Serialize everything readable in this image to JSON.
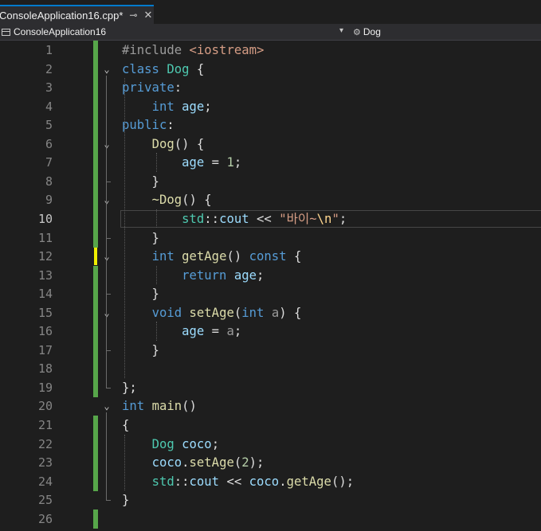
{
  "tab": {
    "title": "ConsoleApplication16.cpp*",
    "pin_icon": "pin-icon",
    "close_icon": "close-icon",
    "pin": "⊸",
    "close": "✕"
  },
  "navbar": {
    "project": "ConsoleApplication16",
    "scope": "Dog",
    "dropdown": "▾",
    "class_icon": "⚙"
  },
  "editor": {
    "active_line": 10,
    "lines": [
      {
        "n": "1"
      },
      {
        "n": "2"
      },
      {
        "n": "3"
      },
      {
        "n": "4"
      },
      {
        "n": "5"
      },
      {
        "n": "6"
      },
      {
        "n": "7"
      },
      {
        "n": "8"
      },
      {
        "n": "9"
      },
      {
        "n": "10"
      },
      {
        "n": "11"
      },
      {
        "n": "12"
      },
      {
        "n": "13"
      },
      {
        "n": "14"
      },
      {
        "n": "15"
      },
      {
        "n": "16"
      },
      {
        "n": "17"
      },
      {
        "n": "18"
      },
      {
        "n": "19"
      },
      {
        "n": "20"
      },
      {
        "n": "21"
      },
      {
        "n": "22"
      },
      {
        "n": "23"
      },
      {
        "n": "24"
      },
      {
        "n": "25"
      },
      {
        "n": "26"
      }
    ],
    "code": [
      [
        {
          "c": "p",
          "x": "#include "
        },
        {
          "c": "i",
          "x": "<iostream>"
        }
      ],
      [
        {
          "c": "k",
          "x": "class "
        },
        {
          "c": "t",
          "x": "Dog"
        },
        {
          "c": "",
          "x": " {"
        }
      ],
      [
        {
          "c": "k",
          "x": "private"
        },
        {
          "c": "",
          "x": ":"
        }
      ],
      [
        {
          "c": "",
          "x": "    "
        },
        {
          "c": "k",
          "x": "int"
        },
        {
          "c": "",
          "x": " "
        },
        {
          "c": "v",
          "x": "age"
        },
        {
          "c": "",
          "x": ";"
        }
      ],
      [
        {
          "c": "k",
          "x": "public"
        },
        {
          "c": "",
          "x": ":"
        }
      ],
      [
        {
          "c": "",
          "x": "    "
        },
        {
          "c": "f",
          "x": "Dog"
        },
        {
          "c": "",
          "x": "() {"
        }
      ],
      [
        {
          "c": "",
          "x": "        "
        },
        {
          "c": "v",
          "x": "age"
        },
        {
          "c": "",
          "x": " = "
        },
        {
          "c": "n",
          "x": "1"
        },
        {
          "c": "",
          "x": ";"
        }
      ],
      [
        {
          "c": "",
          "x": "    }"
        }
      ],
      [
        {
          "c": "",
          "x": "    "
        },
        {
          "c": "f",
          "x": "~Dog"
        },
        {
          "c": "",
          "x": "() {"
        }
      ],
      [
        {
          "c": "",
          "x": "        "
        },
        {
          "c": "t",
          "x": "std"
        },
        {
          "c": "",
          "x": "::"
        },
        {
          "c": "v",
          "x": "cout"
        },
        {
          "c": "",
          "x": " << "
        },
        {
          "c": "s",
          "x": "\"바이~"
        },
        {
          "c": "e",
          "x": "\\n"
        },
        {
          "c": "s",
          "x": "\""
        },
        {
          "c": "",
          "x": ";"
        }
      ],
      [
        {
          "c": "",
          "x": "    }"
        }
      ],
      [
        {
          "c": "",
          "x": "    "
        },
        {
          "c": "k",
          "x": "int"
        },
        {
          "c": "",
          "x": " "
        },
        {
          "c": "f",
          "x": "getAge"
        },
        {
          "c": "",
          "x": "() "
        },
        {
          "c": "k",
          "x": "const"
        },
        {
          "c": "",
          "x": " {"
        }
      ],
      [
        {
          "c": "",
          "x": "        "
        },
        {
          "c": "k",
          "x": "return"
        },
        {
          "c": "",
          "x": " "
        },
        {
          "c": "v",
          "x": "age"
        },
        {
          "c": "",
          "x": ";"
        }
      ],
      [
        {
          "c": "",
          "x": "    }"
        }
      ],
      [
        {
          "c": "",
          "x": "    "
        },
        {
          "c": "k",
          "x": "void"
        },
        {
          "c": "",
          "x": " "
        },
        {
          "c": "f",
          "x": "setAge"
        },
        {
          "c": "",
          "x": "("
        },
        {
          "c": "k",
          "x": "int"
        },
        {
          "c": "",
          "x": " "
        },
        {
          "c": "pm",
          "x": "a"
        },
        {
          "c": "",
          "x": ") {"
        }
      ],
      [
        {
          "c": "",
          "x": "        "
        },
        {
          "c": "v",
          "x": "age"
        },
        {
          "c": "",
          "x": " = "
        },
        {
          "c": "pm",
          "x": "a"
        },
        {
          "c": "",
          "x": ";"
        }
      ],
      [
        {
          "c": "",
          "x": "    }"
        }
      ],
      [
        {
          "c": "",
          "x": ""
        }
      ],
      [
        {
          "c": "",
          "x": "};"
        }
      ],
      [
        {
          "c": "k",
          "x": "int"
        },
        {
          "c": "",
          "x": " "
        },
        {
          "c": "f",
          "x": "main"
        },
        {
          "c": "",
          "x": "()"
        }
      ],
      [
        {
          "c": "",
          "x": "{"
        }
      ],
      [
        {
          "c": "",
          "x": "    "
        },
        {
          "c": "t",
          "x": "Dog"
        },
        {
          "c": "",
          "x": " "
        },
        {
          "c": "v",
          "x": "coco"
        },
        {
          "c": "",
          "x": ";"
        }
      ],
      [
        {
          "c": "",
          "x": "    "
        },
        {
          "c": "v",
          "x": "coco"
        },
        {
          "c": "",
          "x": "."
        },
        {
          "c": "f",
          "x": "setAge"
        },
        {
          "c": "",
          "x": "("
        },
        {
          "c": "n",
          "x": "2"
        },
        {
          "c": "",
          "x": ");"
        }
      ],
      [
        {
          "c": "",
          "x": "    "
        },
        {
          "c": "t",
          "x": "std"
        },
        {
          "c": "",
          "x": "::"
        },
        {
          "c": "v",
          "x": "cout"
        },
        {
          "c": "",
          "x": " << "
        },
        {
          "c": "v",
          "x": "coco"
        },
        {
          "c": "",
          "x": "."
        },
        {
          "c": "f",
          "x": "getAge"
        },
        {
          "c": "",
          "x": "();"
        }
      ],
      [
        {
          "c": "",
          "x": "}"
        }
      ],
      [
        {
          "c": "",
          "x": ""
        }
      ]
    ],
    "fold_lines": [
      2,
      6,
      9,
      12,
      15,
      20
    ],
    "changed_lines": [
      1,
      2,
      3,
      4,
      5,
      6,
      7,
      8,
      9,
      10,
      11,
      13,
      14,
      15,
      16,
      17,
      18,
      19,
      21,
      22,
      23,
      24,
      26
    ],
    "modified_unsaved_line": 12,
    "fold_glyph": "⌄"
  }
}
